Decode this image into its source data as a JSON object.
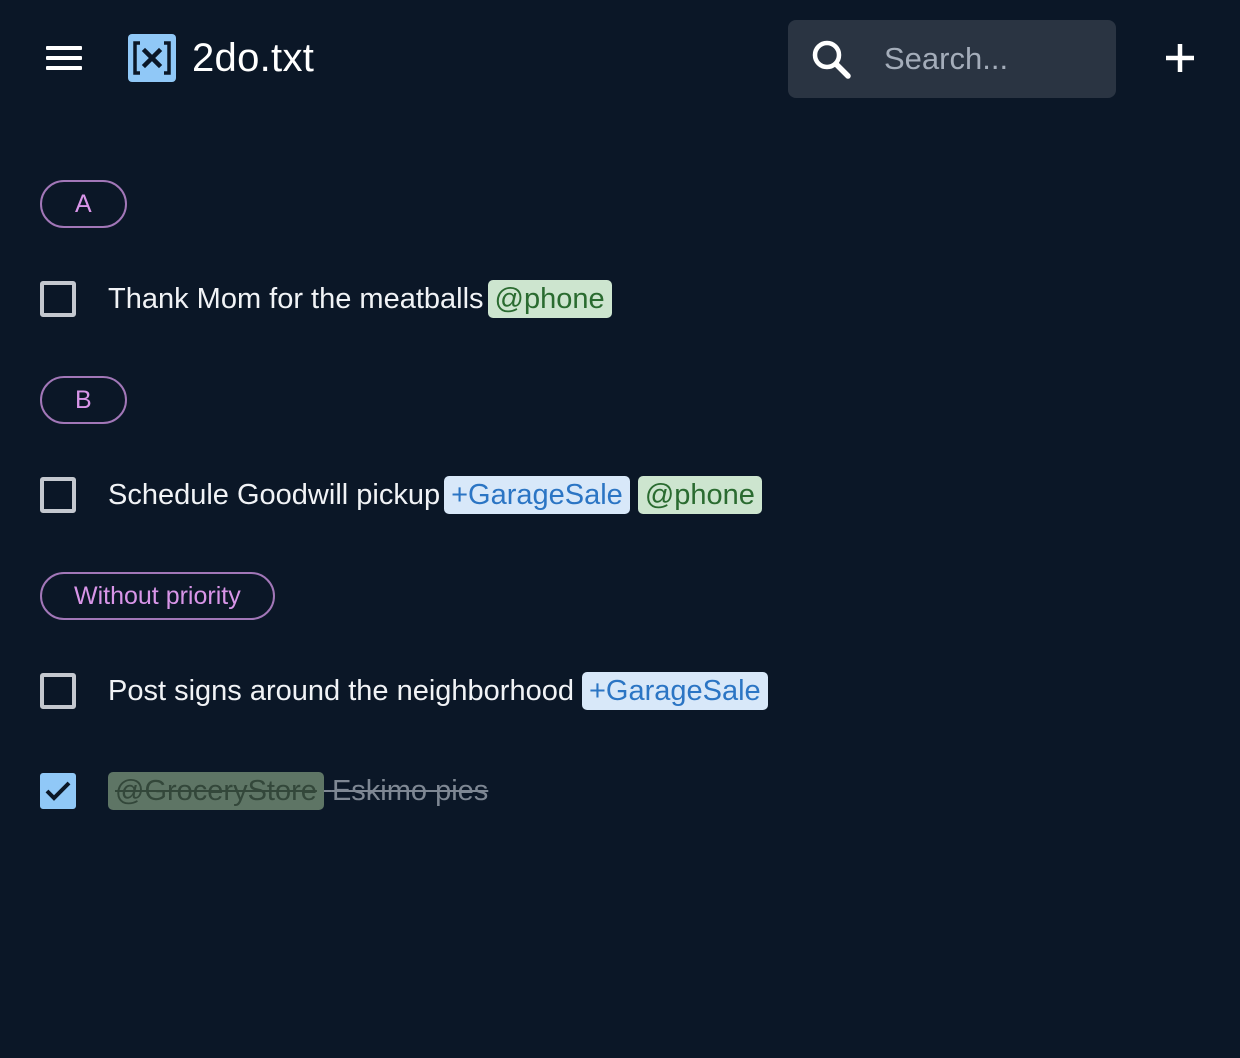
{
  "header": {
    "app_title": "2do.txt",
    "logo_icon": "bracket-x-logo",
    "search_placeholder": "Search...",
    "menu_icon": "hamburger-menu-icon",
    "add_icon": "plus-icon"
  },
  "colors": {
    "background": "#0b1727",
    "chip_border": "#a277b8",
    "chip_text": "#d895e8",
    "context_tag_bg": "#cde5cf",
    "context_tag_text": "#2a6b30",
    "project_tag_bg": "#d8e8f9",
    "project_tag_text": "#2b75c4",
    "checked_box": "#90c8f7"
  },
  "groups": [
    {
      "label": "A",
      "tasks": [
        {
          "text": "Thank Mom for the meatballs",
          "tags": [
            {
              "type": "context",
              "label": "@phone"
            }
          ],
          "completed": false
        }
      ]
    },
    {
      "label": "B",
      "tasks": [
        {
          "text": "Schedule Goodwill pickup",
          "tags": [
            {
              "type": "project",
              "label": "+GarageSale"
            },
            {
              "type": "context",
              "label": "@phone"
            }
          ],
          "completed": false
        }
      ]
    },
    {
      "label": "Without priority",
      "tasks": [
        {
          "text": "Post signs around the neighborhood",
          "tags": [
            {
              "type": "project",
              "label": "+GarageSale"
            }
          ],
          "completed": false
        },
        {
          "leading_tag": {
            "type": "context",
            "label": "@GroceryStore"
          },
          "text": "Eskimo pies",
          "completed": true
        }
      ]
    }
  ]
}
